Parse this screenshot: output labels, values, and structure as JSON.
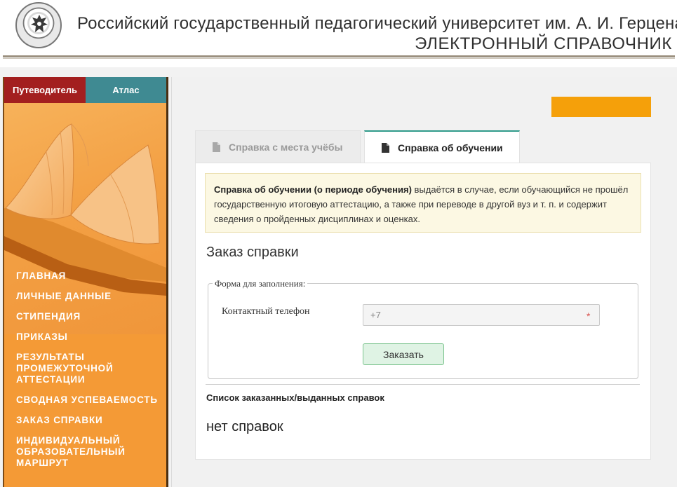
{
  "header": {
    "university_title": "Российский государственный педагогический университет им. А. И. Герцена",
    "subtitle": "ЭЛЕКТРОННЫЙ СПРАВОЧНИК",
    "logo_icon": "university-seal-icon"
  },
  "sidebar": {
    "tabs": [
      {
        "label": "Путеводитель",
        "active": true,
        "color": "#a31f1f"
      },
      {
        "label": "Атлас",
        "active": false,
        "color": "#3f8a92"
      }
    ],
    "menu": [
      {
        "label": "ГЛАВНАЯ"
      },
      {
        "label": "ЛИЧНЫЕ ДАННЫЕ"
      },
      {
        "label": "СТИПЕНДИЯ"
      },
      {
        "label": "ПРИКАЗЫ"
      },
      {
        "label": "РЕЗУЛЬТАТЫ ПРОМЕЖУТОЧНОЙ АТТЕСТАЦИИ"
      },
      {
        "label": "СВОДНАЯ УСПЕВАЕМОСТЬ"
      },
      {
        "label": "ЗАКАЗ СПРАВКИ"
      },
      {
        "label": "ИНДИВИДУАЛЬНЫЙ ОБРАЗОВАТЕЛЬНЫЙ МАРШРУТ"
      }
    ],
    "background_color": "#f49a36"
  },
  "main": {
    "tabs": [
      {
        "label": "Справка с места учёбы",
        "active": false,
        "icon": "document-icon"
      },
      {
        "label": "Справка об обучении",
        "active": true,
        "icon": "document-icon"
      }
    ],
    "notice": {
      "bold": "Справка об обучении (о периоде обучения)",
      "text": " выдаётся в случае, если обучающийся не прошёл государственную итоговую аттестацию, а также при переводе в другой вуз и т. п. и содержит сведения о пройденных дисциплинах и оценках."
    },
    "order_title": "Заказ справки",
    "form": {
      "legend": "Форма для заполнения:",
      "phone_label": "Контактный телефон",
      "phone_value": "+7",
      "required_mark": "*",
      "submit_label": "Заказать"
    },
    "list_title": "Список заказанных/выданных справок",
    "empty_text": "нет справок",
    "accent_color": "#f5a00a"
  }
}
